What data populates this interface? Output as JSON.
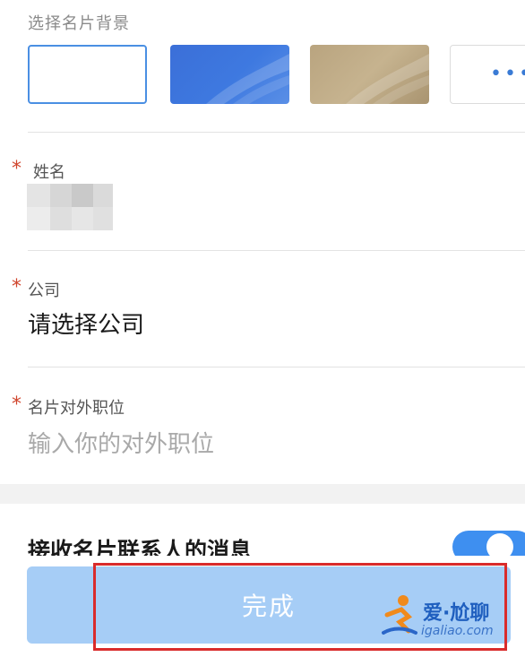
{
  "background_section": {
    "label": "选择名片背景",
    "options": [
      {
        "name": "white",
        "selected": true
      },
      {
        "name": "blue",
        "selected": false
      },
      {
        "name": "gold",
        "selected": false
      }
    ],
    "more_label": "•••"
  },
  "name_field": {
    "required_mark": "*",
    "label": "姓名",
    "value": ""
  },
  "company_field": {
    "required_mark": "*",
    "label": "公司",
    "value": "请选择公司"
  },
  "position_field": {
    "required_mark": "*",
    "label": "名片对外职位",
    "placeholder": "输入你的对外职位"
  },
  "receive_messages": {
    "label": "接收名片联系人的消息",
    "enabled": true
  },
  "footer": {
    "done_label": "完成"
  },
  "watermark": {
    "text": "爱·尬聊",
    "url": "igaliao.com"
  },
  "colors": {
    "accent": "#3e8ff0",
    "required": "#d0452d",
    "done_button": "#a6cdf6",
    "highlight_box": "#d92b2b"
  }
}
